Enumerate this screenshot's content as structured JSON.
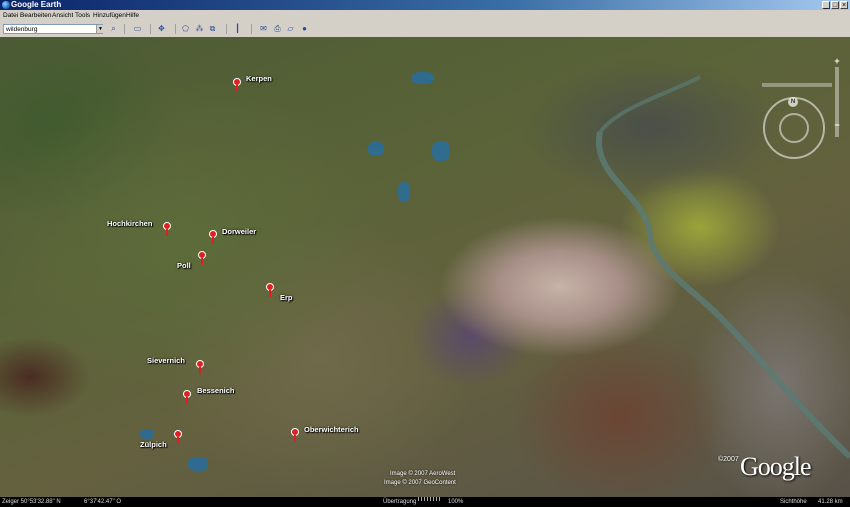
{
  "window": {
    "title": "Google Earth",
    "controls": [
      "_",
      "□",
      "×"
    ]
  },
  "menu": {
    "items": [
      "Datei",
      "Bearbeiten",
      "Ansicht",
      "Tools",
      "Hinzufügen",
      "Hilfe"
    ]
  },
  "toolbar": {
    "search_value": "wildenburg"
  },
  "map": {
    "placemarks": [
      {
        "label": "Kerpen"
      },
      {
        "label": "Hochkirchen"
      },
      {
        "label": "Dorweiler"
      },
      {
        "label": "Poll"
      },
      {
        "label": "Erp"
      },
      {
        "label": "Sievernich"
      },
      {
        "label": "Bessenich"
      },
      {
        "label": "Zülpich"
      },
      {
        "label": "Oberwichterich"
      }
    ],
    "copyright_lines": [
      "Image © 2007 AeroWest",
      "Image © 2007 GeoContent"
    ],
    "google_copyright": "©2007",
    "logo": "Google",
    "compass_north": "N"
  },
  "status": {
    "pointer": "Zeiger  50°53'32.88\" N",
    "longitude": "6°37'42.47\" O",
    "streaming_label": "Übertragung",
    "streaming_percent": "100%",
    "eye_alt": "Sichthöhe",
    "eye_alt_value": "41.28 km"
  },
  "colors": {
    "title_bar": "#0a246a",
    "pin": "#e02020",
    "chrome": "#d4d0c8"
  }
}
